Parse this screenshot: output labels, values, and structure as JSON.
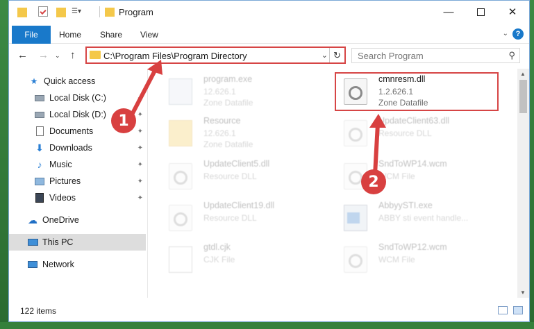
{
  "window": {
    "title": "Program"
  },
  "ribbon": {
    "tabs": [
      "File",
      "Home",
      "Share",
      "View"
    ],
    "help": "?"
  },
  "address": {
    "path": "C:\\Program Files\\Program Directory"
  },
  "search": {
    "placeholder": "Search Program"
  },
  "sidebar": {
    "items": [
      {
        "label": "Quick access"
      },
      {
        "label": "Local Disk (C:)"
      },
      {
        "label": "Local Disk (D:)"
      },
      {
        "label": "Documents"
      },
      {
        "label": "Downloads"
      },
      {
        "label": "Music"
      },
      {
        "label": "Pictures"
      },
      {
        "label": "Videos"
      },
      {
        "label": "OneDrive"
      },
      {
        "label": "This PC"
      },
      {
        "label": "Network"
      }
    ]
  },
  "files": [
    {
      "name": "program.exe",
      "version": "12.626.1",
      "type": "Zone Datafile"
    },
    {
      "name": "cmnresm.dll",
      "version": "1.2.626.1",
      "type": "Zone Datafile"
    },
    {
      "name": "Resource",
      "version": "12.626.1",
      "type": "Zone Datafile"
    },
    {
      "name": "UpdateClient63.dll",
      "version": "Resource DLL",
      "type": ""
    },
    {
      "name": "UpdateClient5.dll",
      "version": "Resource DLL",
      "type": ""
    },
    {
      "name": "SndToWP14.wcm",
      "version": "WCM File",
      "type": ""
    },
    {
      "name": "UpdateClient19.dll",
      "version": "Resource DLL",
      "type": ""
    },
    {
      "name": "AbbyySTI.exe",
      "version": "ABBY sti event handle...",
      "type": ""
    },
    {
      "name": "gtdl.cjk",
      "version": "CJK File",
      "type": ""
    },
    {
      "name": "SndToWP12.wcm",
      "version": "WCM File",
      "type": ""
    }
  ],
  "status": {
    "item_count": "122 items"
  },
  "annotations": {
    "step1": "1",
    "step2": "2"
  },
  "colors": {
    "accent": "#1979ca",
    "highlight": "#d64545"
  }
}
